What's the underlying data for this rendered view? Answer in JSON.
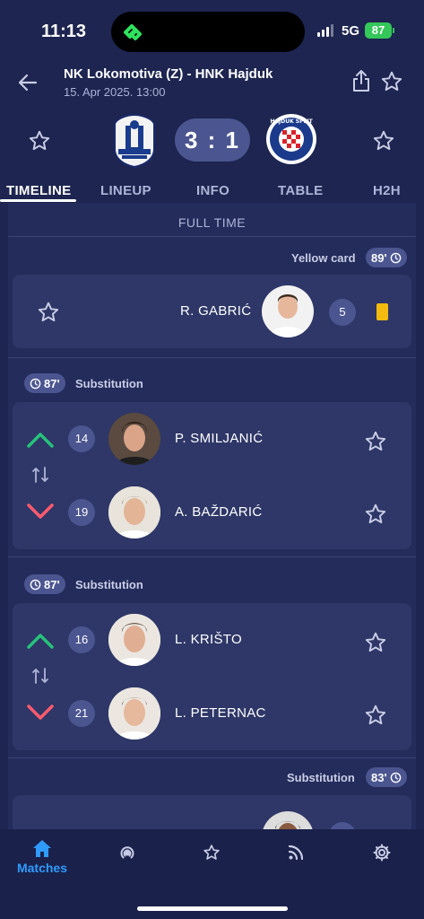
{
  "status_bar": {
    "time": "11:13",
    "network": "5G",
    "battery": "87"
  },
  "header": {
    "title": "NK Lokomotiva (Z) - HNK Hajduk",
    "date": "15. Apr 2025. 13:00"
  },
  "scoreboard": {
    "score": "3 : 1",
    "home_crest": "lokomotiva-crest",
    "away_crest": "hajduk-crest",
    "away_crest_text": "HAJDUK SPLIT"
  },
  "tabs": [
    "TIMELINE",
    "LINEUP",
    "INFO",
    "TABLE",
    "H2H"
  ],
  "active_tab": "TIMELINE",
  "timeline": {
    "status": "FULL TIME",
    "events": [
      {
        "type": "Yellow card",
        "minute": "89'",
        "player": "R. GABRIĆ",
        "number": "5"
      },
      {
        "type": "Substitution",
        "minute": "87'",
        "player_in": "P. SMILJANIĆ",
        "number_in": "14",
        "player_out": "A. BAŽDARIĆ",
        "number_out": "19"
      },
      {
        "type": "Substitution",
        "minute": "87'",
        "player_in": "L. KRIŠTO",
        "number_in": "16",
        "player_out": "L. PETERNAC",
        "number_out": "21"
      },
      {
        "type": "Substitution",
        "minute": "83'"
      }
    ]
  },
  "bottom_nav": {
    "matches_label": "Matches",
    "icons": [
      "home-icon",
      "live-icon",
      "favorites-icon",
      "news-icon",
      "settings-icon"
    ]
  },
  "colors": {
    "background": "#1d2550",
    "card": "#2e3767",
    "accent": "#2f9bff",
    "up_arrow": "#27c27a",
    "down_arrow": "#ff5b6e",
    "yellow_card": "#f2b90f"
  }
}
